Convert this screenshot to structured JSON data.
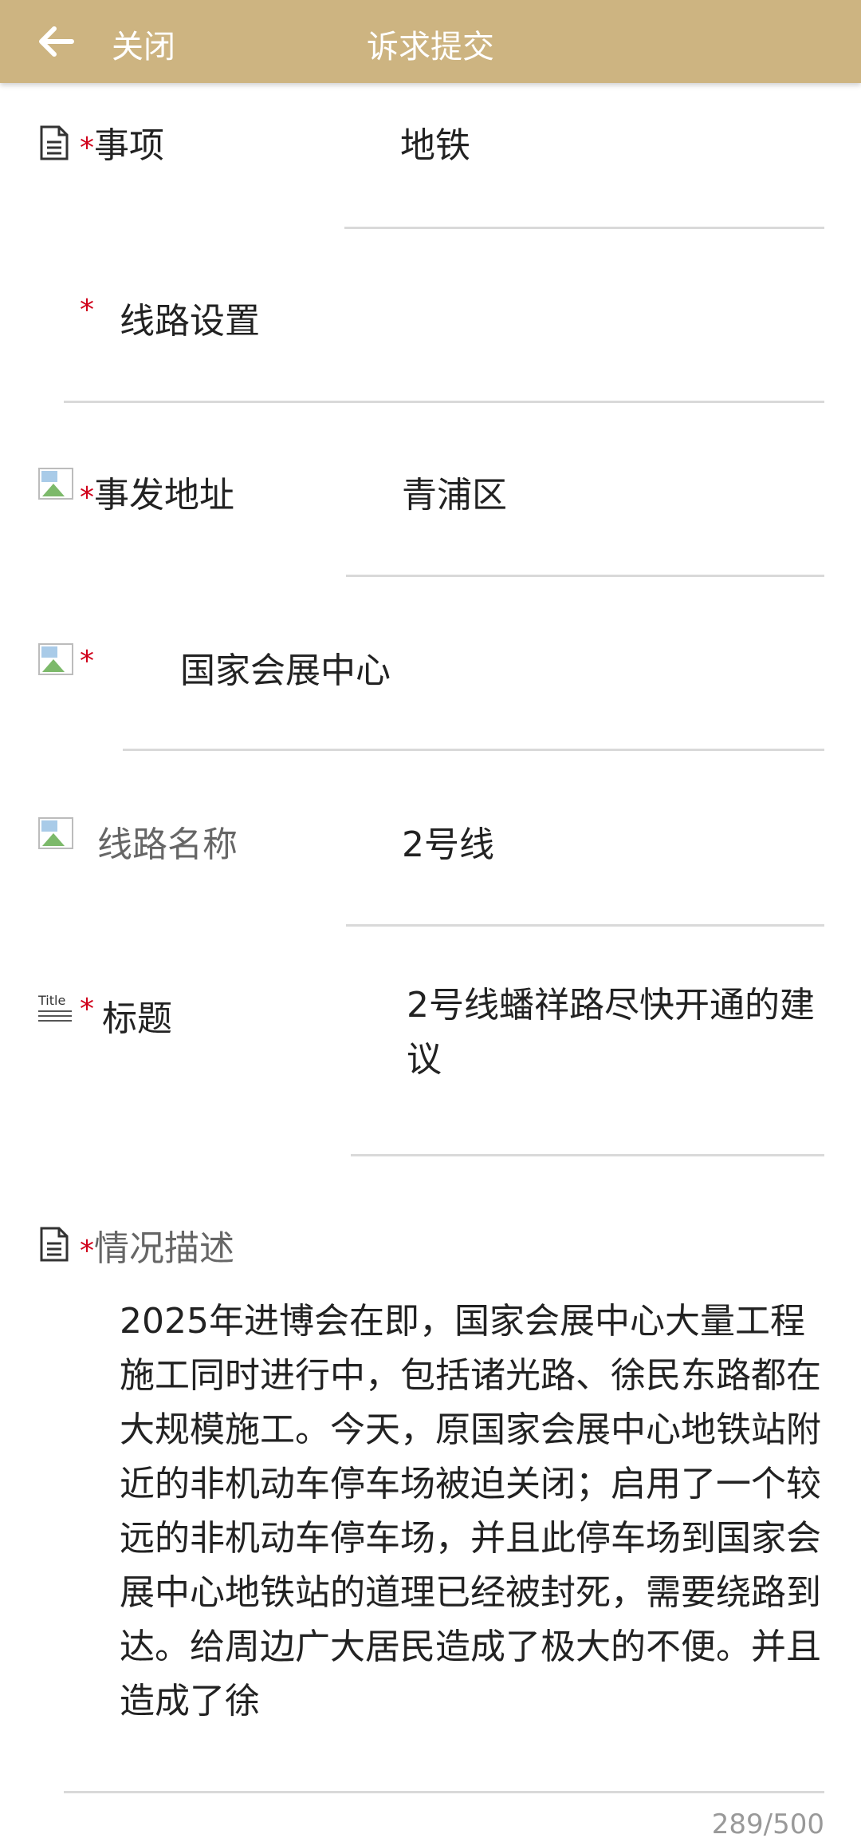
{
  "header": {
    "close_label": "关闭",
    "title": "诉求提交"
  },
  "fields": {
    "matter": {
      "label": "*事项",
      "value": "地铁"
    },
    "route_setting": {
      "required": "*",
      "value": "线路设置"
    },
    "address": {
      "label": "*事发地址",
      "value": "青浦区"
    },
    "station": {
      "required": "*",
      "value": "国家会展中心"
    },
    "line_name": {
      "label": "线路名称",
      "value": "2号线"
    },
    "title_field": {
      "icon_text": "Title",
      "required": "*",
      "label": "标题",
      "value": "2号线蟠祥路尽快开通的建议"
    },
    "description": {
      "label": "*情况描述",
      "value": "2025年进博会在即，国家会展中心大量工程施工同时进行中，包括诸光路、徐民东路都在大规模施工。今天，原国家会展中心地铁站附近的非机动车停车场被迫关闭；启用了一个较远的非机动车停车场，并且此停车场到国家会展中心地铁站的道理已经被封死，需要绕路到达。给周边广大居民造成了极大的不便。并且造成了徐",
      "counter": "289/500"
    }
  },
  "colors": {
    "header": "#cdb481",
    "required": "#d0021b"
  }
}
